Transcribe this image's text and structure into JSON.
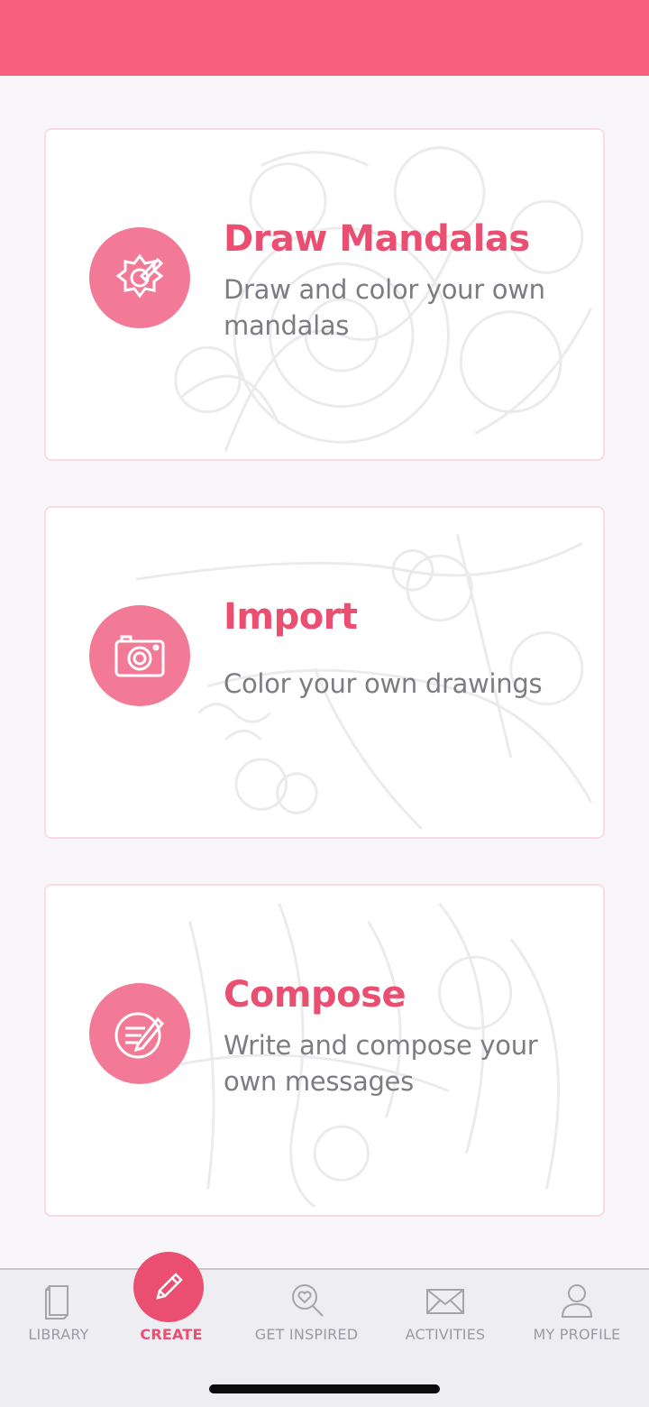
{
  "colors": {
    "accent": "#f85f7d",
    "title": "#ea4f72",
    "icon_bg": "#f27a96",
    "nav_inactive": "#9a9aa2"
  },
  "cards": [
    {
      "icon": "mandala-pencil-icon",
      "title": "Draw Mandalas",
      "description": "Draw and color your own mandalas"
    },
    {
      "icon": "camera-icon",
      "title": "Import",
      "description": "Color your own drawings"
    },
    {
      "icon": "compose-pencil-icon",
      "title": "Compose",
      "description": "Write and compose your own messages"
    }
  ],
  "bottom_nav": {
    "items": [
      {
        "label": "LIBRARY",
        "icon": "book-icon",
        "active": false
      },
      {
        "label": "CREATE",
        "icon": "pencil-icon",
        "active": true
      },
      {
        "label": "GET INSPIRED",
        "icon": "heart-search-icon",
        "active": false
      },
      {
        "label": "ACTIVITIES",
        "icon": "envelope-icon",
        "active": false
      },
      {
        "label": "MY PROFILE",
        "icon": "person-icon",
        "active": false
      }
    ]
  }
}
